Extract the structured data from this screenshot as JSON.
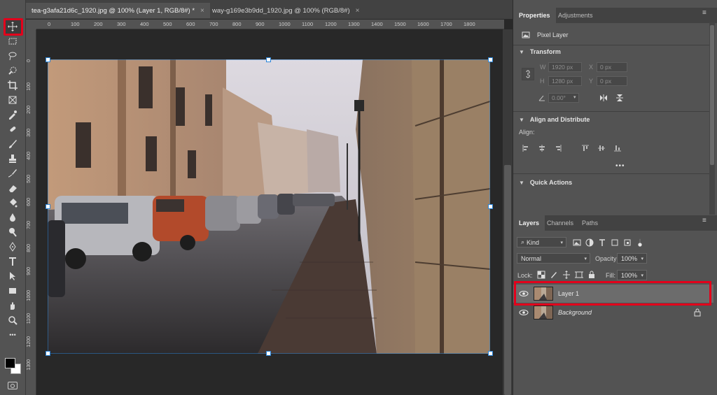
{
  "document_tabs": [
    {
      "label": "tea-g3afa21d6c_1920.jpg @ 100% (Layer 1, RGB/8#) *",
      "close": "×"
    },
    {
      "label": "way-g169e3b9dd_1920.jpg @ 100% (RGB/8#)",
      "close": "×"
    }
  ],
  "ruler_h": [
    "0",
    "100",
    "200",
    "300",
    "400",
    "500",
    "600",
    "700",
    "800",
    "900",
    "1000",
    "1100",
    "1200",
    "1300",
    "1400",
    "1500",
    "1600",
    "1700",
    "1800"
  ],
  "ruler_v": [
    "0",
    "100",
    "200",
    "300",
    "400",
    "500",
    "600",
    "700",
    "800",
    "900",
    "1000",
    "1100",
    "1200",
    "1300"
  ],
  "toolbar": {
    "tools": [
      "move-icon",
      "marquee-icon",
      "lasso-icon",
      "quick-select-icon",
      "crop-icon",
      "frame-icon",
      "eyedropper-icon",
      "healing-brush-icon",
      "brush-icon",
      "clone-stamp-icon",
      "history-brush-icon",
      "eraser-icon",
      "paint-bucket-icon",
      "blur-icon",
      "dodge-icon",
      "pen-icon",
      "type-icon",
      "path-select-icon",
      "rectangle-icon",
      "hand-icon",
      "zoom-icon",
      "more-icon"
    ],
    "more_label": "•••"
  },
  "properties": {
    "tabs": [
      "Properties",
      "Adjustments"
    ],
    "kind_label": "Pixel Layer",
    "transform_title": "Transform",
    "w_label": "W",
    "w_value": "1920 px",
    "x_label": "X",
    "x_value": "0 px",
    "h_label": "H",
    "h_value": "1280 px",
    "y_label": "Y",
    "y_value": "0 px",
    "angle_value": "0.00°",
    "align_title": "Align and Distribute",
    "align_label": "Align:",
    "align_more": "•••",
    "quick_actions_title": "Quick Actions"
  },
  "layers_panel": {
    "tabs": [
      "Layers",
      "Channels",
      "Paths"
    ],
    "filter_label": "Kind",
    "blend_mode": "Normal",
    "opacity_label": "Opacity:",
    "opacity_value": "100%",
    "lock_label": "Lock:",
    "fill_label": "Fill:",
    "fill_value": "100%",
    "layers": [
      {
        "name": "Layer 1",
        "selected": true
      },
      {
        "name": "Background",
        "selected": false
      }
    ]
  },
  "colors": {
    "highlight": "#e3001b",
    "selection": "#2a84d8",
    "panel": "#535353",
    "canvas": "#282828"
  }
}
